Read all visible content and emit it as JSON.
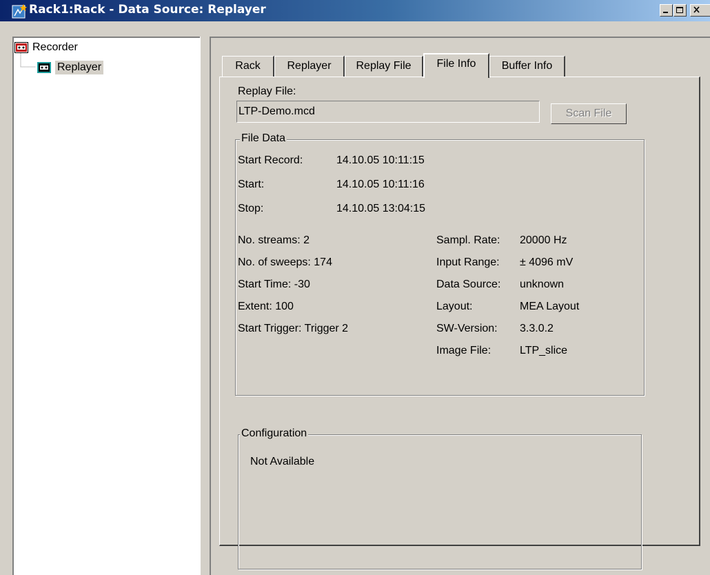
{
  "window": {
    "title": "Rack1:Rack - Data Source: Replayer"
  },
  "tree": {
    "items": [
      {
        "label": "Recorder",
        "icon": "recorder-icon"
      },
      {
        "label": "Replayer",
        "icon": "replayer-icon",
        "selected": true
      }
    ]
  },
  "tabs": [
    {
      "label": "Rack"
    },
    {
      "label": "Replayer"
    },
    {
      "label": "Replay File"
    },
    {
      "label": "File Info",
      "active": true
    },
    {
      "label": "Buffer Info"
    }
  ],
  "replay_file": {
    "label": "Replay File:",
    "value": "LTP-Demo.mcd",
    "scan_button": "Scan File"
  },
  "file_data": {
    "legend": "File Data",
    "start_record": {
      "label": "Start Record:",
      "value": "14.10.05 10:11:15"
    },
    "start": {
      "label": "Start:",
      "value": "14.10.05 10:11:16"
    },
    "stop": {
      "label": "Stop:",
      "value": "14.10.05 13:04:15"
    },
    "left": [
      "No. streams: 2",
      "No. of sweeps: 174",
      "Start Time: -30",
      "Extent: 100",
      "Start Trigger: Trigger 2"
    ],
    "right": [
      {
        "label": "Sampl. Rate:",
        "value": "20000 Hz"
      },
      {
        "label": "Input Range:",
        "value": "± 4096 mV"
      },
      {
        "label": "Data Source:",
        "value": "unknown"
      },
      {
        "label": "Layout:",
        "value": "MEA Layout"
      },
      {
        "label": "SW-Version:",
        "value": "3.3.0.2"
      },
      {
        "label": "Image File:",
        "value": "LTP_slice"
      }
    ]
  },
  "configuration": {
    "legend": "Configuration",
    "text": "Not Available"
  },
  "colors": {
    "titlebar_start": "#0a246a",
    "titlebar_end": "#a6caf0",
    "face": "#d4d0c8",
    "icon_teal": "#1a9a9a"
  }
}
